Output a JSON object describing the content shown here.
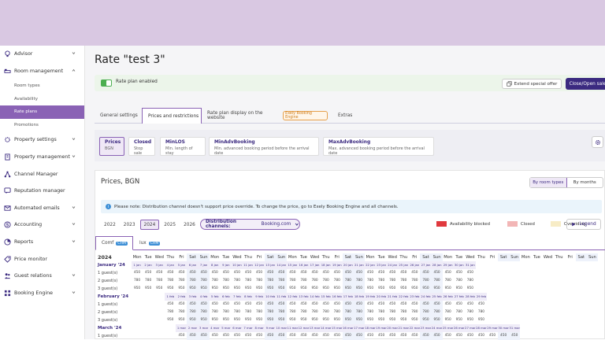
{
  "sidebar": {
    "items": [
      {
        "label": "Advisor",
        "icon": "bulb-icon",
        "chevron": true
      },
      {
        "label": "Room management",
        "icon": "bed-icon",
        "chevron": false,
        "expanded": true
      }
    ],
    "sub": [
      {
        "label": "Room types",
        "active": false
      },
      {
        "label": "Availability",
        "active": false
      },
      {
        "label": "Rate plans",
        "active": true
      },
      {
        "label": "Promotions",
        "active": false
      }
    ],
    "more": [
      {
        "label": "Property settings",
        "icon": "gear-icon",
        "chevron": true
      },
      {
        "label": "Property management",
        "icon": "building-icon",
        "chevron": true
      },
      {
        "label": "Channel Manager",
        "icon": "network-icon",
        "chevron": false
      },
      {
        "label": "Reputation manager",
        "icon": "chat-icon",
        "chevron": false
      },
      {
        "label": "Automated emails",
        "icon": "mail-icon",
        "chevron": true
      },
      {
        "label": "Accounting",
        "icon": "dollar-icon",
        "chevron": true
      },
      {
        "label": "Reports",
        "icon": "report-icon",
        "chevron": true
      },
      {
        "label": "Price monitor",
        "icon": "price-tag-icon",
        "chevron": false
      },
      {
        "label": "Guest relations",
        "icon": "guests-icon",
        "chevron": true
      },
      {
        "label": "Booking Engine",
        "icon": "grid-icon",
        "chevron": true
      }
    ]
  },
  "page": {
    "title": "Rate \"test 3\""
  },
  "banner": {
    "label": "Rate plan enabled",
    "extend_btn": "Extend special offer",
    "close_btn": "Close/Open sales"
  },
  "tabs": [
    {
      "label": "General settings"
    },
    {
      "label": "Prices and restrictions"
    },
    {
      "label": "Rate plan display on the website"
    },
    {
      "label": "Extras"
    }
  ],
  "tab_badge": "Exely Booking Engine",
  "restrictions": [
    {
      "title": "Prices",
      "sub": "BGN"
    },
    {
      "title": "Closed",
      "sub": "Stop sale"
    },
    {
      "title": "MinLOS",
      "sub": "Min. length of stay"
    },
    {
      "title": "MinAdvBooking",
      "sub": "Min. advanced booking period before the arrival date"
    },
    {
      "title": "MaxAdvBooking",
      "sub": "Max. advanced booking period before the arrival date"
    }
  ],
  "prices": {
    "title": "Prices, BGN",
    "view_room": "By room types",
    "view_month": "By months",
    "info": "Please note: Distribution channel doesn't support price override. To change the price, go to Exely Booking Engine and all channels.",
    "years": [
      "2022",
      "2023",
      "2024",
      "2025",
      "2026"
    ],
    "active_year": "2024",
    "channel_label": "Distribution channels:",
    "channel_value": "Booking.com",
    "legend": [
      {
        "label": "Availability blocked",
        "color": "#e0393e"
      },
      {
        "label": "Closed",
        "color": "#f2b6b6"
      },
      {
        "label": "Overriding",
        "color": "#f7ecc6"
      }
    ],
    "legend_btn": "Legend",
    "room_tabs": [
      {
        "label": "Comf",
        "badge": "CHM"
      },
      {
        "label": "lux",
        "badge": "CHM"
      }
    ],
    "grid": {
      "year": "2024",
      "weekdays": [
        "Mon",
        "Tue",
        "Wed",
        "Thu",
        "Fri",
        "Sat",
        "Sun",
        "Mon",
        "Tue",
        "Wed",
        "Thu",
        "Fri",
        "Sat",
        "Sun",
        "Mon",
        "Tue",
        "Wed",
        "Thu",
        "Fri",
        "Sat",
        "Sun",
        "Mon",
        "Tue",
        "Wed",
        "Thu",
        "Fri",
        "Sat",
        "Sun",
        "Mon",
        "Tue",
        "Wed",
        "Thu",
        "Fri",
        "Sat",
        "Sun",
        "Mon",
        "Tue",
        "Wed",
        "Thu",
        "Fri",
        "Sat",
        "Sun"
      ],
      "rows": [
        {
          "type": "month",
          "label": "January '24",
          "cells": [
            "1 jan",
            "2 jan",
            "3 jan",
            "4 jan",
            "5 jan",
            "6 jan",
            "7 jan",
            "8 jan",
            "9 jan",
            "10 jan",
            "11 jan",
            "12 jan",
            "13 jan",
            "14 jan",
            "15 jan",
            "16 jan",
            "17 jan",
            "18 jan",
            "19 jan",
            "20 jan",
            "21 jan",
            "22 jan",
            "23 jan",
            "24 jan",
            "25 jan",
            "26 jan",
            "27 jan",
            "28 jan",
            "29 jan",
            "30 jan",
            "31 jan",
            "",
            "",
            "",
            "",
            "",
            "",
            "",
            "",
            "",
            "",
            ""
          ]
        },
        {
          "type": "price",
          "label": "1 guest(s)",
          "cells": [
            "450",
            "450",
            "450",
            "450",
            "450",
            "450",
            "450",
            "450",
            "450",
            "450",
            "450",
            "450",
            "450",
            "450",
            "450",
            "450",
            "450",
            "450",
            "450",
            "450",
            "450",
            "450",
            "450",
            "450",
            "450",
            "450",
            "450",
            "450",
            "450",
            "450",
            "450",
            "",
            "",
            "",
            "",
            "",
            "",
            "",
            "",
            "",
            "",
            ""
          ]
        },
        {
          "type": "price",
          "label": "2 guest(s)",
          "cells": [
            "780",
            "780",
            "780",
            "780",
            "780",
            "780",
            "780",
            "780",
            "780",
            "780",
            "780",
            "780",
            "780",
            "780",
            "780",
            "780",
            "780",
            "780",
            "780",
            "780",
            "780",
            "780",
            "780",
            "780",
            "780",
            "780",
            "780",
            "780",
            "780",
            "780",
            "780",
            "",
            "",
            "",
            "",
            "",
            "",
            "",
            "",
            "",
            "",
            ""
          ]
        },
        {
          "type": "price",
          "label": "3 guest(s)",
          "cells": [
            "950",
            "950",
            "950",
            "950",
            "950",
            "950",
            "950",
            "950",
            "950",
            "950",
            "950",
            "950",
            "950",
            "950",
            "950",
            "950",
            "950",
            "950",
            "950",
            "950",
            "950",
            "950",
            "950",
            "950",
            "950",
            "950",
            "950",
            "950",
            "950",
            "950",
            "950",
            "",
            "",
            "",
            "",
            "",
            "",
            "",
            "",
            "",
            "",
            ""
          ]
        },
        {
          "type": "month",
          "label": "February '24",
          "cells": [
            "",
            "",
            "",
            "1 feb",
            "2 feb",
            "3 feb",
            "4 feb",
            "5 feb",
            "6 feb",
            "7 feb",
            "8 feb",
            "9 feb",
            "10 feb",
            "11 feb",
            "12 feb",
            "13 feb",
            "14 feb",
            "15 feb",
            "16 feb",
            "17 feb",
            "18 feb",
            "19 feb",
            "20 feb",
            "21 feb",
            "22 feb",
            "23 feb",
            "24 feb",
            "25 feb",
            "26 feb",
            "27 feb",
            "28 feb",
            "29 feb",
            "",
            "",
            "",
            "",
            "",
            "",
            "",
            "",
            "",
            ""
          ]
        },
        {
          "type": "price",
          "label": "1 guest(s)",
          "cells": [
            "",
            "",
            "",
            "450",
            "450",
            "450",
            "450",
            "450",
            "450",
            "450",
            "450",
            "450",
            "450",
            "450",
            "450",
            "450",
            "450",
            "450",
            "450",
            "450",
            "450",
            "450",
            "450",
            "450",
            "450",
            "450",
            "450",
            "450",
            "450",
            "450",
            "450",
            "450",
            "",
            "",
            "",
            "",
            "",
            "",
            "",
            "",
            "",
            ""
          ]
        },
        {
          "type": "price",
          "label": "2 guest(s)",
          "cells": [
            "",
            "",
            "",
            "780",
            "780",
            "780",
            "780",
            "780",
            "780",
            "780",
            "780",
            "780",
            "780",
            "780",
            "780",
            "780",
            "780",
            "780",
            "780",
            "780",
            "780",
            "780",
            "780",
            "780",
            "780",
            "780",
            "780",
            "780",
            "780",
            "780",
            "780",
            "780",
            "",
            "",
            "",
            "",
            "",
            "",
            "",
            "",
            "",
            ""
          ]
        },
        {
          "type": "price",
          "label": "3 guest(s)",
          "cells": [
            "",
            "",
            "",
            "950",
            "950",
            "950",
            "950",
            "950",
            "950",
            "950",
            "950",
            "950",
            "950",
            "950",
            "950",
            "950",
            "950",
            "950",
            "950",
            "950",
            "950",
            "950",
            "950",
            "950",
            "950",
            "950",
            "950",
            "950",
            "950",
            "950",
            "950",
            "950",
            "",
            "",
            "",
            "",
            "",
            "",
            "",
            "",
            "",
            ""
          ]
        },
        {
          "type": "month",
          "label": "March '24",
          "cells": [
            "",
            "",
            "",
            "",
            "1 mar",
            "2 mar",
            "3 mar",
            "4 mar",
            "5 mar",
            "6 mar",
            "7 mar",
            "8 mar",
            "9 mar",
            "10 mar",
            "11 mar",
            "12 mar",
            "13 mar",
            "14 mar",
            "15 mar",
            "16 mar",
            "17 mar",
            "18 mar",
            "19 mar",
            "20 mar",
            "21 mar",
            "22 mar",
            "23 mar",
            "24 mar",
            "25 mar",
            "26 mar",
            "27 mar",
            "28 mar",
            "29 mar",
            "30 mar",
            "31 mar",
            "",
            "",
            "",
            "",
            "",
            "",
            ""
          ]
        },
        {
          "type": "price",
          "label": "1 guest(s)",
          "cells": [
            "",
            "",
            "",
            "",
            "450",
            "450",
            "450",
            "450",
            "450",
            "450",
            "450",
            "450",
            "450",
            "450",
            "450",
            "450",
            "450",
            "450",
            "450",
            "450",
            "450",
            "450",
            "450",
            "450",
            "450",
            "450",
            "450",
            "450",
            "450",
            "450",
            "450",
            "450",
            "450",
            "450",
            "450",
            "",
            "",
            "",
            "",
            "",
            "",
            ""
          ]
        }
      ]
    }
  }
}
